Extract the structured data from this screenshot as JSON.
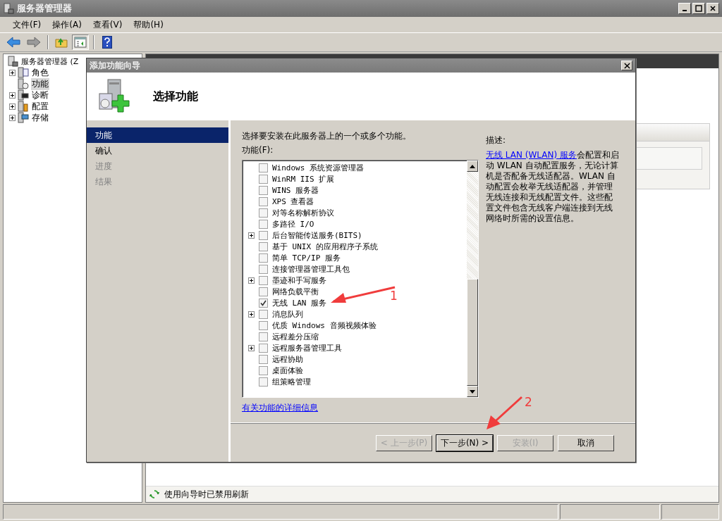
{
  "window": {
    "title": "服务器管理器"
  },
  "menu": [
    {
      "label": "文件(F)"
    },
    {
      "label": "操作(A)"
    },
    {
      "label": "查看(V)"
    },
    {
      "label": "帮助(H)"
    }
  ],
  "toolbar": [
    {
      "kind": "back",
      "pressed": false
    },
    {
      "kind": "forward",
      "pressed": false
    },
    {
      "kind": "sep"
    },
    {
      "kind": "up",
      "pressed": false
    },
    {
      "kind": "pane",
      "pressed": true
    },
    {
      "kind": "sep"
    },
    {
      "kind": "help",
      "pressed": false
    }
  ],
  "tree": {
    "label": "服务器管理器 (Z",
    "children": [
      {
        "label": "角色",
        "expanded": false,
        "selected": false,
        "kind": "roles"
      },
      {
        "label": "功能",
        "selected": true,
        "kind": "features"
      },
      {
        "label": "诊断",
        "expanded": false,
        "selected": false,
        "kind": "diagnostics"
      },
      {
        "label": "配置",
        "expanded": false,
        "selected": false,
        "kind": "configuration"
      },
      {
        "label": "存储",
        "expanded": false,
        "selected": false,
        "kind": "storage"
      }
    ]
  },
  "status": {
    "text": "使用向导时已禁用刷新"
  },
  "dialog": {
    "title": "添加功能向导",
    "heading": "选择功能",
    "steps": [
      {
        "label": "功能",
        "selected": true,
        "disabled": false
      },
      {
        "label": "确认",
        "selected": false,
        "disabled": false
      },
      {
        "label": "进度",
        "selected": false,
        "disabled": true
      },
      {
        "label": "结果",
        "selected": false,
        "disabled": true
      }
    ],
    "instruction": "选择要安装在此服务器上的一个或多个功能。",
    "list_label": "功能(F):",
    "features": [
      {
        "label": "Windows 系统资源管理器",
        "checked": false
      },
      {
        "label": "WinRM IIS 扩展",
        "checked": false
      },
      {
        "label": "WINS 服务器",
        "checked": false
      },
      {
        "label": "XPS 查看器",
        "checked": false
      },
      {
        "label": "对等名称解析协议",
        "checked": false
      },
      {
        "label": "多路径 I/O",
        "checked": false
      },
      {
        "label": "后台智能传送服务(BITS)",
        "checked": false,
        "expanded": false
      },
      {
        "label": "基于 UNIX 的应用程序子系统",
        "checked": false
      },
      {
        "label": "简单 TCP/IP 服务",
        "checked": false
      },
      {
        "label": "连接管理器管理工具包",
        "checked": false
      },
      {
        "label": "墨迹和手写服务",
        "checked": false,
        "expanded": false
      },
      {
        "label": "网络负载平衡",
        "checked": false
      },
      {
        "label": "无线 LAN 服务",
        "checked": true
      },
      {
        "label": "消息队列",
        "checked": false,
        "expanded": false
      },
      {
        "label": "优质 Windows 音频视频体验",
        "checked": false
      },
      {
        "label": "远程差分压缩",
        "checked": false
      },
      {
        "label": "远程服务器管理工具",
        "checked": false,
        "expanded": false
      },
      {
        "label": "远程协助",
        "checked": false
      },
      {
        "label": "桌面体验",
        "checked": false
      },
      {
        "label": "组策略管理",
        "checked": false
      }
    ],
    "description_label": "描述:",
    "description": {
      "link": "无线 LAN (WLAN) 服务",
      "text": "会配置和启动 WLAN 自动配置服务，无论计算机是否配备无线适配器。WLAN 自动配置会枚举无线适配器，并管理无线连接和无线配置文件。这些配置文件包含无线客户端连接到无线网络时所需的设置信息。"
    },
    "more_link": "有关功能的详细信息",
    "buttons": [
      {
        "label": "< 上一步(P)",
        "disabled": true,
        "default": false
      },
      {
        "label": "下一步(N) >",
        "disabled": false,
        "default": true
      },
      {
        "label": "安装(I)",
        "disabled": true,
        "default": false
      },
      {
        "label": "取消",
        "disabled": false,
        "default": false
      }
    ]
  },
  "annotations": [
    {
      "label": "1"
    },
    {
      "label": "2"
    }
  ]
}
